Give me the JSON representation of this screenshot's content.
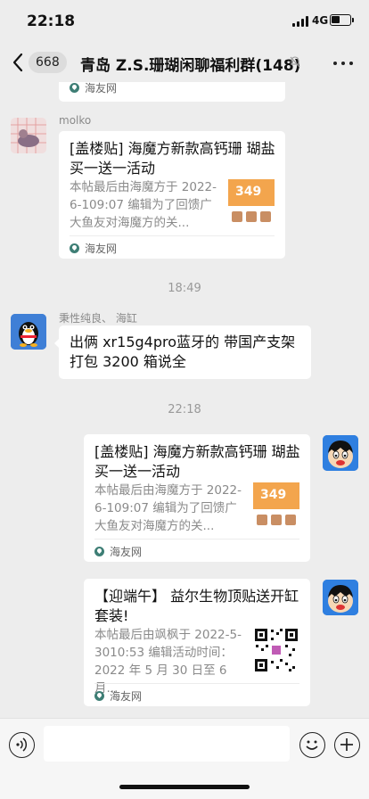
{
  "status_bar": {
    "time": "22:18",
    "network": "4G"
  },
  "nav": {
    "unread_count": "668",
    "title": "青岛 Z.S.珊瑚闲聊福利群(148)"
  },
  "messages": {
    "top_card": {
      "source": "海友网"
    },
    "msg1": {
      "sender": "molko",
      "title": "[盖楼贴] 海魔方新款高钙珊 瑚盐买一送一活动",
      "desc": "本帖最后由海魔方于 2022-6-109:07 编辑为了回馈广大鱼友对海魔方的关...",
      "thumb_price": "349",
      "source": "海友网"
    },
    "time1": "18:49",
    "msg2": {
      "sender": "秉性纯良、 海缸",
      "text": "出俩 xr15g4pro蓝牙的 带国产支架 打包 3200 箱说全"
    },
    "time2": "22:18",
    "msg3": {
      "title": "[盖楼贴] 海魔方新款高钙珊 瑚盐买一送一活动",
      "desc": "本帖最后由海魔方于 2022-6-109:07 编辑为了回馈广大鱼友对海魔方的关...",
      "thumb_price": "349",
      "source": "海友网"
    },
    "msg4": {
      "title": "【迎端午】 益尔生物顶贴送开缸套装!",
      "desc": "本帖最后由飒枫于 2022-5-3010:53 编辑活动时间：2022 年 5 月 30 日至 6 月...",
      "source": "海友网"
    }
  },
  "colors": {
    "chat_bg": "#ededed",
    "bubble_bg": "#ffffff",
    "thumb_orange": "#f3a54d"
  }
}
